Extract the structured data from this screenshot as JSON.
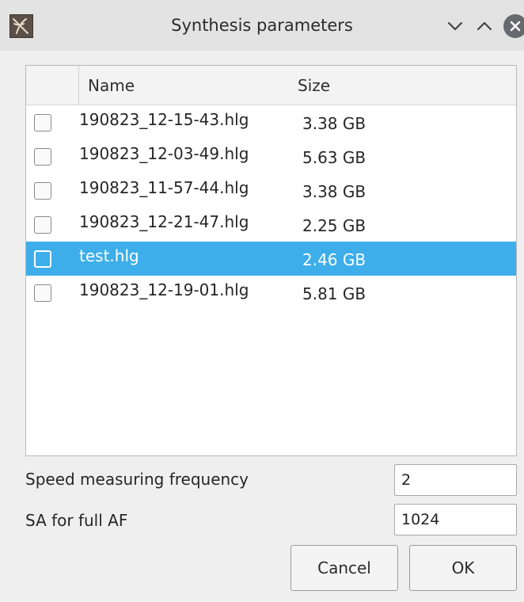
{
  "window": {
    "title": "Synthesis parameters"
  },
  "list": {
    "columns": [
      "Name",
      "Size"
    ],
    "rows": [
      {
        "name": "190823_12-15-43.hlg",
        "size": "3.38 GB",
        "selected": false
      },
      {
        "name": "190823_12-03-49.hlg",
        "size": "5.63 GB",
        "selected": false
      },
      {
        "name": "190823_11-57-44.hlg",
        "size": "3.38 GB",
        "selected": false
      },
      {
        "name": "190823_12-21-47.hlg",
        "size": "2.25 GB",
        "selected": false
      },
      {
        "name": "test.hlg",
        "size": "2.46 GB",
        "selected": true
      },
      {
        "name": "190823_12-19-01.hlg",
        "size": "5.81 GB",
        "selected": false
      }
    ]
  },
  "form": {
    "speed_label": "Speed measuring frequency",
    "speed_value": "2",
    "sa_label": "SA for full AF",
    "sa_value": "1024"
  },
  "buttons": {
    "cancel": "Cancel",
    "ok": "OK"
  },
  "colors": {
    "selection": "#3daee9",
    "titlebar": "#e3e3e3",
    "window_bg": "#efefef"
  },
  "icons": {
    "app": "app-icon",
    "minimize": "chevron-down-icon",
    "maximize": "chevron-up-icon",
    "close": "close-icon"
  }
}
